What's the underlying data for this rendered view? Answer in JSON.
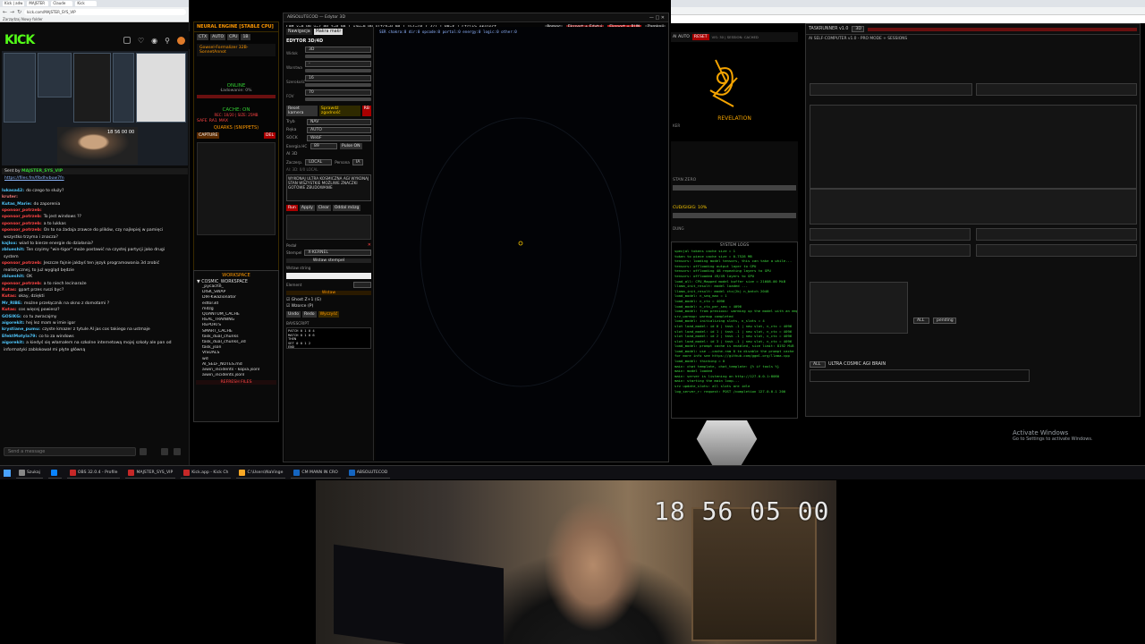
{
  "browser": {
    "tabs": [
      "Kick | adw",
      "MAJSTER",
      "Claude",
      "Kick"
    ],
    "url": "kick.com/MAJSTER_SYS_VIP",
    "bookmarks": "Zarządzaj  Nowy folder"
  },
  "kick": {
    "logo": "KICK",
    "stream_clock": "18 56 00 00"
  },
  "chat": {
    "pinned_by": "Sent by",
    "pinned_user": "MAJSTER_SYS_VIP",
    "pinned_link": "https://files.fm/f/bdhvbuw7fn",
    "messages": [
      {
        "nick": "lukasa42:",
        "color": "#4fc3f7",
        "text": "do czego to służy?"
      },
      {
        "nick": "kruter:",
        "color": "#e57373",
        "text": ""
      },
      {
        "nick": "Kutas_Marie:",
        "color": "#4fc3f7",
        "text": "do zaporenia"
      },
      {
        "nick": "sponsor_potrzeb:",
        "color": "#f44",
        "text": ""
      },
      {
        "nick": "sponsor_potrzeb:",
        "color": "#f44",
        "text": "To jest windows ??"
      },
      {
        "nick": "sponsor_potrzeb:",
        "color": "#f44",
        "text": "a to lukkas"
      },
      {
        "nick": "sponsor_potrzeb:",
        "color": "#f44",
        "text": "On to na żadaja zrawce do plików, czy najlepiej w pamięci"
      },
      {
        "nick": "",
        "color": "#ddd",
        "text": "wszystko trzyma i znacza?"
      },
      {
        "nick": "kajlox:",
        "color": "#4fc3f7",
        "text": "wiad to bierze energie do działania?"
      },
      {
        "nick": "zblueshit:",
        "color": "#4fc3f7",
        "text": "Ten czyimy \"win-tigor\" może postawić na czystej partycji jako drugi"
      },
      {
        "nick": "",
        "color": "#ddd",
        "text": "system"
      },
      {
        "nick": "sponsor_potrzeb:",
        "color": "#f44",
        "text": "Jeszcze fajnie jakbyś ten język programowania 3d zrobić"
      },
      {
        "nick": "",
        "color": "#ddd",
        "text": "realistycznej, to już wygląd będzie"
      },
      {
        "nick": "zblueshit:",
        "color": "#4fc3f7",
        "text": "OK"
      },
      {
        "nick": "sponsor_potrzeb:",
        "color": "#f44",
        "text": "a to niech lecinaraże"
      },
      {
        "nick": "Kutas:",
        "color": "#f44",
        "text": "gpart przes ruszi byc?"
      },
      {
        "nick": "Kutas:",
        "color": "#f44",
        "text": "okay, dziękti"
      },
      {
        "nick": "Mr_RIBE:",
        "color": "#4fc3f7",
        "text": "możne przełącznik na okno z domotami ?"
      },
      {
        "nick": "Kutas:",
        "color": "#f44",
        "text": "cos więcej powiesz?"
      },
      {
        "nick": "GOSIKG:",
        "color": "#4fc3f7",
        "text": "co tu zwracajmy"
      },
      {
        "nick": "aigorekit:",
        "color": "#4fc3f7",
        "text": "hej lez mam w imie igor"
      },
      {
        "nick": "krystiane_pumu:",
        "color": "#4fc3f7",
        "text": "czyste kmazer z tytule AI jas cos takiego na ustmaje"
      },
      {
        "nick": "EfektMotyla79:",
        "color": "#4fc3f7",
        "text": "co to za windows"
      },
      {
        "nick": "aigorekit:",
        "color": "#4fc3f7",
        "text": "a kiedyś się włamałem na szkolne internetową mojej szkoły ale pan od"
      },
      {
        "nick": "",
        "color": "#ddd",
        "text": "informatyki zablokował mi płyte główną"
      }
    ],
    "input_placeholder": "Send a message"
  },
  "neural": {
    "title": "NEURAL ENGINE [STABLE CPU]",
    "model": "Gowsel-Formalizer 32B-SonnetAnnot",
    "status": "ONLINE",
    "loading": "Ładowanie: 0%",
    "cache": "CACHE: ON",
    "cache_info": "REC: 10/20 | SIZE: 25MB",
    "quarks": "QUARKS (SNIPPETS)",
    "capture": "CAPTURE",
    "del": "DEL",
    "safe": "SAFE",
    "ra1": "RA1",
    "max": "MAX"
  },
  "workspace": {
    "title": "WORKSPACE",
    "root": "COSMIC_WORKSPACE",
    "items": [
      "_pycache_",
      "DISK_SWAP",
      "DIR-Kwazionator",
      "edtor3d",
      "mdzg",
      "QUANTUM_CACHE",
      "REAL_TRAINING",
      "REPORTS",
      "SMART_CACHE",
      "task_dual_chunks",
      "task_dual_chunks_3d",
      "task_json",
      "VISUALS",
      "wd",
      "AI_SELF_NOTES.md",
      "aiwin_incidents - kopia.jsonl",
      "aiwin_incidents.jsonl"
    ],
    "refresh": "REFRESH FILES"
  },
  "editor": {
    "titlebar": "ABSOLUTECOD — Edytor 3D",
    "coords": "CAM x=0.00 y=7.00 z=0.00 | yaw=0.00 pitch=0.00 | TGT=(0,7,32) | BR=X | Ctrl+S eksport",
    "btn_help": "Pomoc",
    "btn_export": "Eksport + Edytuj",
    "btn_run": "Eksport + RUN",
    "btn_close": "Zamknij",
    "tab_nav": "Nawigacja",
    "tab_macro": "Makra makr",
    "panel_title": "EDYTOR 3D/4D",
    "status_line": "SER  chakra:0  dir:0  opcode:0  portal:0  energy:0  logic:0  other:0",
    "fields": [
      {
        "label": "Widok",
        "value": "3D"
      },
      {
        "label": "Warstwa",
        "value": "-"
      },
      {
        "label": "Szerokość",
        "value": "16"
      },
      {
        "label": "FOV",
        "value": "70"
      }
    ],
    "reset_cam": "Reset kamera",
    "check_consistency": "Sprawdź zgodność",
    "rb": "RB",
    "mode_label": "Tryb",
    "mode_value": "NAV",
    "hand_label": "Ręka",
    "hand_value": "AUTO",
    "sock_label": "SOCK",
    "sock_value": "WebF",
    "energy_label": "Energia HC",
    "energy_value": "89",
    "pulse": "Pulse ON",
    "ai_label": "AI 3D",
    "source_label": "Zaczerp.",
    "source_value": "LOCAL",
    "persona_label": "Persona",
    "persona_value": "IA",
    "apply_count": "AI: 3D: 0/0 LOCAL",
    "ai_prompt": "WYKONAJ ULTRA KOSMICZNA AGI WYKONAJ STAN WSZYSTKIE MOŻLIWE ZNACZKI GOTOWE ZBUDOWANIE",
    "btn_run_small": "Run",
    "btn_apply": "Apply",
    "btn_clear": "Clear",
    "btn_zoom": "Oddal mózg",
    "pedal_label": "Pedał",
    "stamp_label": "Stempel",
    "stamp_value": "X-KERNEL",
    "insert_stamp": "Wstaw stempel",
    "insert_string": "Wstaw string",
    "element_label": "Element",
    "insert": "Wstaw",
    "ghost": "Ghost Z+1 (G)",
    "pattern": "Wzorce (P)",
    "undo": "Undo",
    "redo": "Redo",
    "clear": "Wyczyść",
    "bytecode_title": "BAYESCRIPT",
    "bytecode": [
      "PATCH 0 1 0 4",
      "MATCH 0 1 0 6",
      "THEN",
      "SET 0 0 1 2",
      "END"
    ]
  },
  "revelation": {
    "header": "AI AUTO",
    "reset": "RESET",
    "info": "VIS: 30 | SESSION: CACHED",
    "label": "REVELATION",
    "ker": "KER"
  },
  "sysmid": {
    "stan": "STAN ZERO",
    "cud": "CUD/GIGIG: 10%",
    "dung": "DUNG"
  },
  "syslogs": {
    "title": "SYSTEM LOGS",
    "lines": [
      "specjal tokens cache size = 1",
      "token to piece cache size = 0.7528 MB",
      "tensors: loading model tensors, this can take a while...",
      "tensors: offloading output layer to GPU",
      "tensors: offloading 48 repeating layers to GPU",
      "tensors: offloaded 49/49 layers to GPU",
      "load_all: CPU_Mapped model buffer size = 21608.00 MiB",
      "llama_init_result: model loaded ...",
      "llama_init_result: model ctx(2k) n_batch 2048",
      "load_model: n_seq_max = 1",
      "load_model: n_ctx = 4096",
      "load_model: n_ctx_per_seq = 4096",
      "load_model: from previous: warming up the model with an empty run",
      "srv_warmup: warmup completed",
      "load_model: initializing slots, n_slots = 4",
      "slot load_model: id 0 | task -1 | new slot, n_ctx = 4096",
      "slot load_model: id 1 | task -1 | new slot, n_ctx = 4096",
      "slot load_model: id 2 | task -1 | new slot, n_ctx = 4096",
      "slot load_model: id 3 | task -1 | new slot, n_ctx = 4096",
      "load_model: prompt cache is enabled, size limit: 8192 MiB",
      "load_model: use --cache-ram 0 to disable the prompt cache",
      "for more info see https://github.com/ggml-org/llama.cpp",
      "load_model: thinking = 0",
      "main: chat template, chat_template: {% if tools %}",
      "main: model loaded",
      "main: server is listening on http://127.0.0.1:8080",
      "main: starting the main loop...",
      "srv update_slots: all slots are idle",
      "log_server_r: request: POST /completion 127.0.0.1 200"
    ]
  },
  "taskrunner": {
    "title": "TASKRUNNER v1.0",
    "mode": "3D",
    "subtitle": "AI SELF-COMPUTER v1.0 - PRO MODE + SESSIONS",
    "agi_label": "ULTRA COSMIC AGI BRAIN",
    "pending": "pending",
    "all": "ALL"
  },
  "windows_notice": {
    "title": "Activate Windows",
    "sub": "Go to Settings to activate Windows."
  },
  "taskbar": {
    "items": [
      {
        "label": "Szukaj",
        "color": "#888"
      },
      {
        "label": "",
        "color": "#0a84ff"
      },
      {
        "label": "OBS 32.0.4 - Profile",
        "color": "#c62828"
      },
      {
        "label": "MAJSTER_SYS_VIP",
        "color": "#c62828"
      },
      {
        "label": "Kick.app - Kick Ch",
        "color": "#c62828"
      },
      {
        "label": "C:\\Users\\NaVinge",
        "color": "#f9a825"
      },
      {
        "label": "CM MANN IN CRO",
        "color": "#1565c0"
      },
      {
        "label": "ABSOLUTECOD",
        "color": "#1565c0"
      }
    ]
  },
  "webcam": {
    "timecode": "18 56 05 00"
  }
}
